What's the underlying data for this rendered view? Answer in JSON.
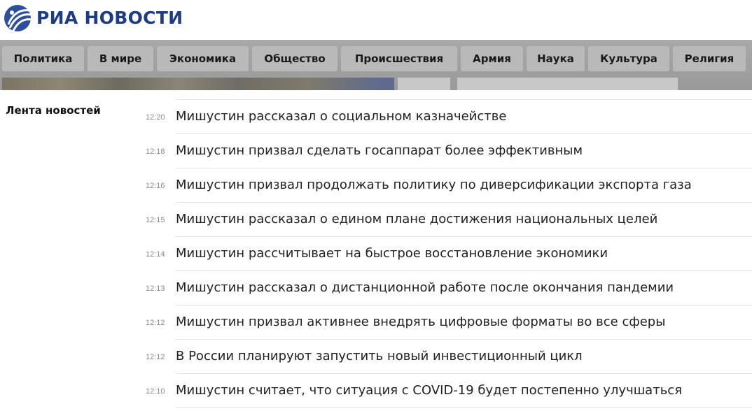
{
  "header": {
    "logo_text": "РИА НОВОСТИ",
    "logo_icon": "ria-globe-icon",
    "brand_color": "#1d3b86"
  },
  "nav": {
    "items": [
      {
        "label": "Политика"
      },
      {
        "label": "В мире"
      },
      {
        "label": "Экономика"
      },
      {
        "label": "Общество"
      },
      {
        "label": "Происшествия"
      },
      {
        "label": "Армия"
      },
      {
        "label": "Наука"
      },
      {
        "label": "Культура"
      },
      {
        "label": "Религия"
      }
    ]
  },
  "feed": {
    "title": "Лента новостей",
    "items": [
      {
        "time": "12:20",
        "headline": "Мишустин рассказал о социальном казначействе"
      },
      {
        "time": "12:18",
        "headline": "Мишустин призвал сделать госаппарат более эффективным"
      },
      {
        "time": "12:16",
        "headline": "Мишустин призвал продолжать политику по диверсификации экспорта газа"
      },
      {
        "time": "12:15",
        "headline": "Мишустин рассказал о едином плане достижения национальных целей"
      },
      {
        "time": "12:14",
        "headline": "Мишустин рассчитывает на быстрое восстановление экономики"
      },
      {
        "time": "12:13",
        "headline": "Мишустин рассказал о дистанционной работе после окончания пандемии"
      },
      {
        "time": "12:12",
        "headline": "Мишустин призвал активнее внедрять цифровые форматы во все сферы"
      },
      {
        "time": "12:12",
        "headline": "В России планируют запустить новый инвестиционный цикл"
      },
      {
        "time": "12:10",
        "headline": "Мишустин считает, что ситуация с COVID-19 будет постепенно улучшаться"
      }
    ]
  }
}
